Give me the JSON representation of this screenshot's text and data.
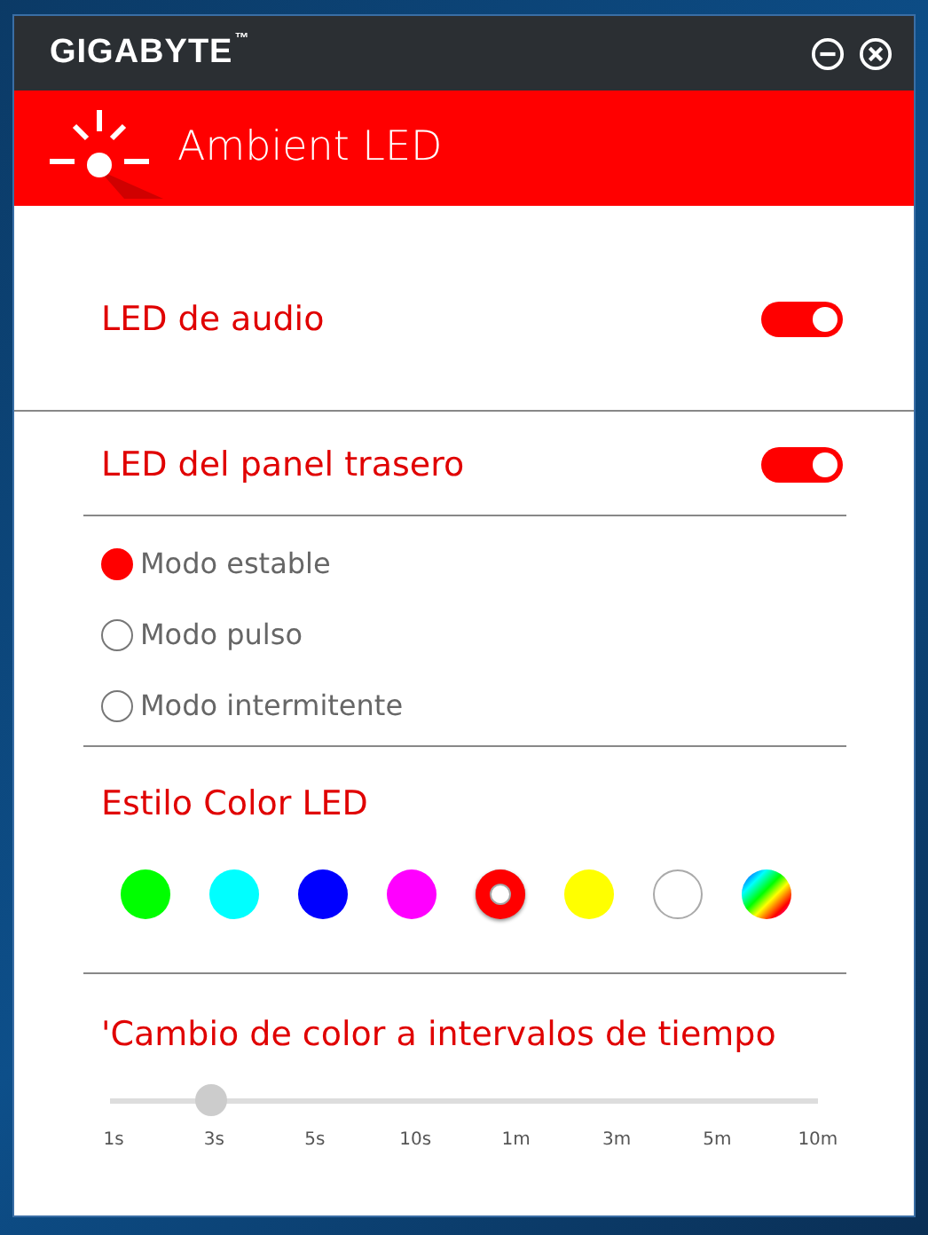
{
  "window": {
    "brand": "GIGABYTE",
    "trademark": "™"
  },
  "header": {
    "title": "Ambient LED"
  },
  "switches": [
    {
      "label": "LED de audio",
      "on": true
    },
    {
      "label": "LED del panel trasero",
      "on": true
    }
  ],
  "modes": [
    {
      "label": "Modo estable",
      "selected": true
    },
    {
      "label": "Modo pulso",
      "selected": false
    },
    {
      "label": "Modo intermitente",
      "selected": false
    }
  ],
  "color_style": {
    "title": "Estilo Color LED",
    "swatches": [
      {
        "kind": "solid",
        "color": "#00ff00",
        "selected": false
      },
      {
        "kind": "solid",
        "color": "#00ffff",
        "selected": false
      },
      {
        "kind": "solid",
        "color": "#0000ff",
        "selected": false
      },
      {
        "kind": "solid",
        "color": "#ff00ff",
        "selected": false
      },
      {
        "kind": "solid",
        "color": "#ff0000",
        "selected": true
      },
      {
        "kind": "solid",
        "color": "#ffff00",
        "selected": false
      },
      {
        "kind": "solid",
        "color": "#ffffff",
        "selected": false
      },
      {
        "kind": "rainbow",
        "selected": false
      }
    ]
  },
  "interval": {
    "title": "'Cambio de color a intervalos de tiempo",
    "level": 0.143,
    "ticks": [
      "1s",
      "3s",
      "5s",
      "10s",
      "1m",
      "3m",
      "5m",
      "10m"
    ]
  }
}
